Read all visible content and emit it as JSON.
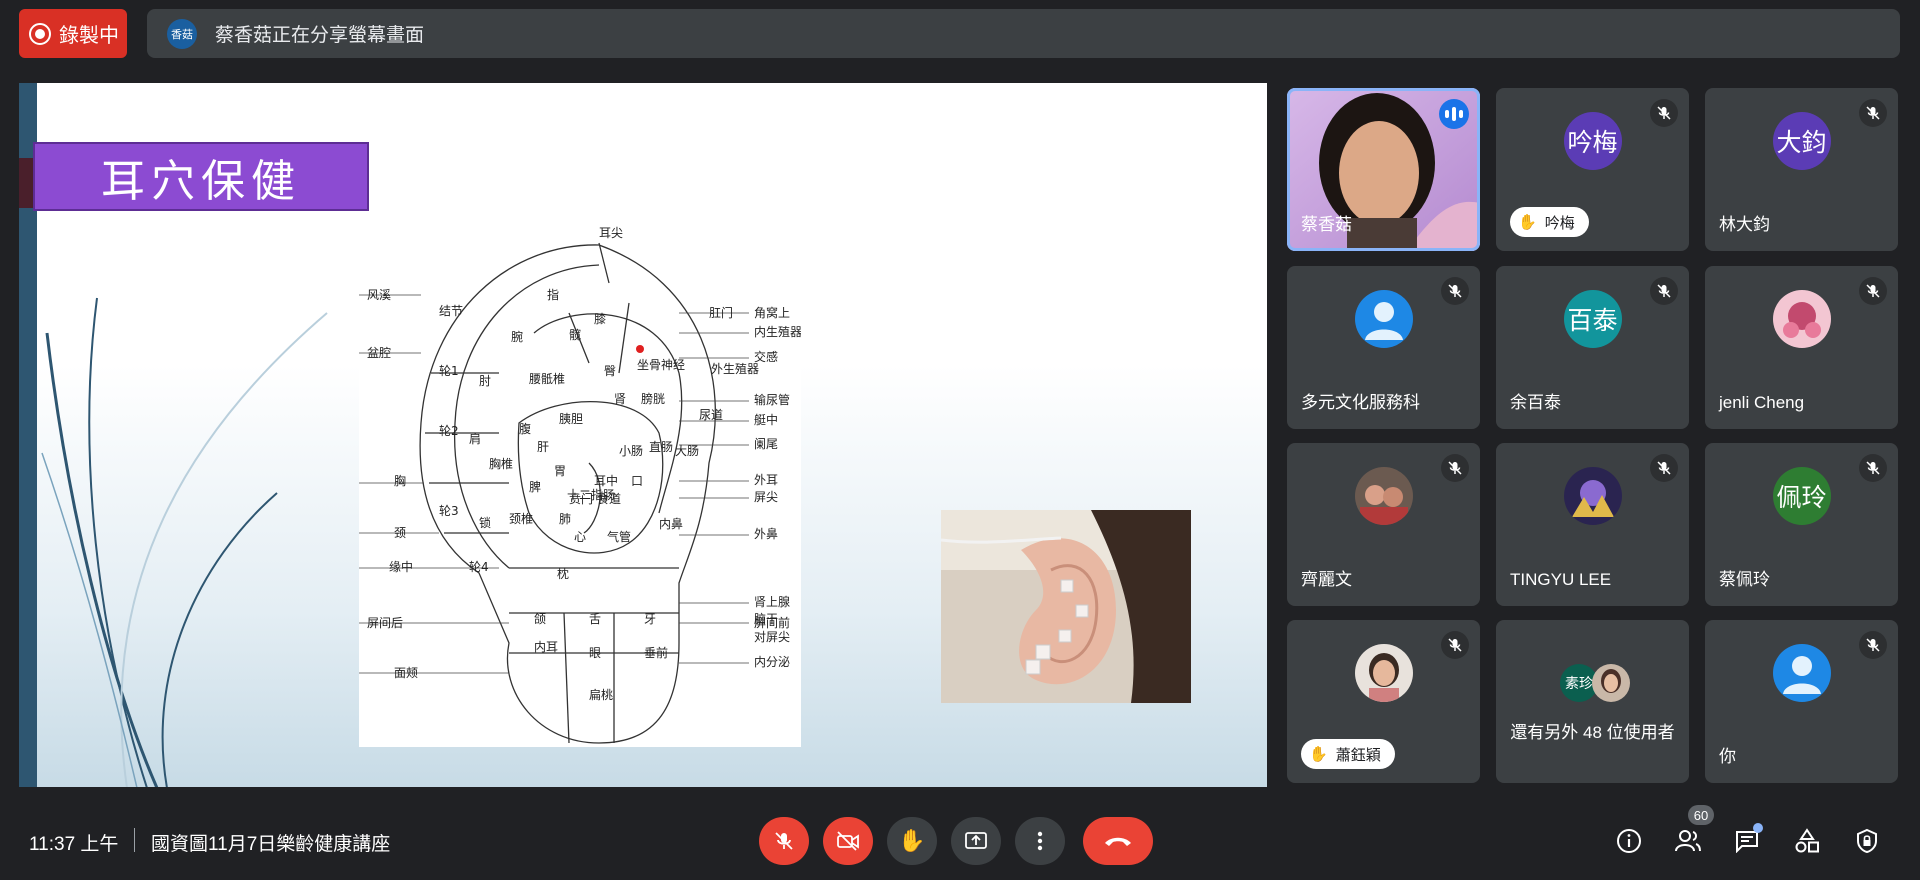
{
  "recording": {
    "label": "錄製中"
  },
  "share_banner": {
    "avatar_text": "香菇",
    "text": "蔡香菇正在分享螢幕畫面"
  },
  "slide": {
    "title": "耳穴保健",
    "ear_chart_labels": [
      "耳尖",
      "风溪",
      "结节",
      "指",
      "膝",
      "肛门",
      "角窝上",
      "内生殖器",
      "盆腔",
      "腕",
      "髋",
      "坐骨神经",
      "外生殖器",
      "交感",
      "轮1",
      "肘",
      "腰骶椎",
      "臀",
      "输尿管",
      "艇中",
      "轮2",
      "肩",
      "腹",
      "肾",
      "膀胱",
      "尿道",
      "阑尾",
      "胸椎",
      "肝",
      "胰胆",
      "小肠",
      "大肠",
      "直肠",
      "外耳",
      "胸",
      "轮3",
      "胃",
      "十二指肠",
      "耳中",
      "口",
      "屏尖",
      "颈",
      "锁",
      "颈椎",
      "脾",
      "食道",
      "贲门",
      "肺",
      "心",
      "气管",
      "外鼻",
      "肾上腺",
      "缘中",
      "轮4",
      "枕",
      "内鼻",
      "脑干",
      "对屏尖",
      "内分泌",
      "屏间后",
      "颌",
      "舌",
      "牙",
      "屏间前",
      "面颊",
      "内耳",
      "眼",
      "垂前",
      "扁桃"
    ]
  },
  "participants": [
    {
      "name": "蔡香菇",
      "speaking": true,
      "color": "#c9a9d9"
    },
    {
      "name": "吟梅",
      "initials": "吟梅",
      "avatar_color": "#5b3cb5",
      "hand_raised": true,
      "muted": true
    },
    {
      "name": "林大鈞",
      "initials": "大鈞",
      "avatar_color": "#5b3cb5",
      "muted": true
    },
    {
      "name": "多元文化服務科",
      "avatar_color": "#1e88e5",
      "muted": true
    },
    {
      "name": "余百泰",
      "initials": "百泰",
      "avatar_color": "#12959c",
      "muted": true
    },
    {
      "name": "jenli Cheng",
      "avatar_color": "#c24a6e",
      "muted": true
    },
    {
      "name": "齊麗文",
      "avatar_color": "#8a4a3a",
      "muted": true
    },
    {
      "name": "TINGYU LEE",
      "avatar_color": "#4b3a8a",
      "muted": true
    },
    {
      "name": "蔡佩玲",
      "initials": "佩玲",
      "avatar_color": "#2e7d32",
      "muted": true
    },
    {
      "name": "蕭鈺穎",
      "avatar_color": "#b39b8a",
      "hand_raised": true,
      "muted": true
    },
    {
      "name": "還有另外 48 位使用者",
      "mini_avatar_text": "素珍",
      "mini_avatar_color": "#0b5f4f"
    },
    {
      "name": "你",
      "avatar_color": "#1e88e5",
      "muted": true
    }
  ],
  "bottom_bar": {
    "time": "11:37 上午",
    "meeting_title": "國資圖11月7日樂齡健康講座",
    "people_count": "60"
  },
  "icons": {
    "record": "record-icon",
    "mic_off": "mic-off-icon",
    "cam_off": "camera-off-icon",
    "hand": "raise-hand-icon",
    "present": "present-screen-icon",
    "more": "more-vert-icon",
    "end_call": "end-call-icon",
    "info": "info-icon",
    "people": "people-icon",
    "chat": "chat-icon",
    "activities": "activities-icon",
    "host_controls": "host-controls-icon"
  },
  "colors": {
    "red": "#ea4335",
    "blue": "#1a73e8",
    "tile": "#3c4043",
    "background": "#202124"
  }
}
